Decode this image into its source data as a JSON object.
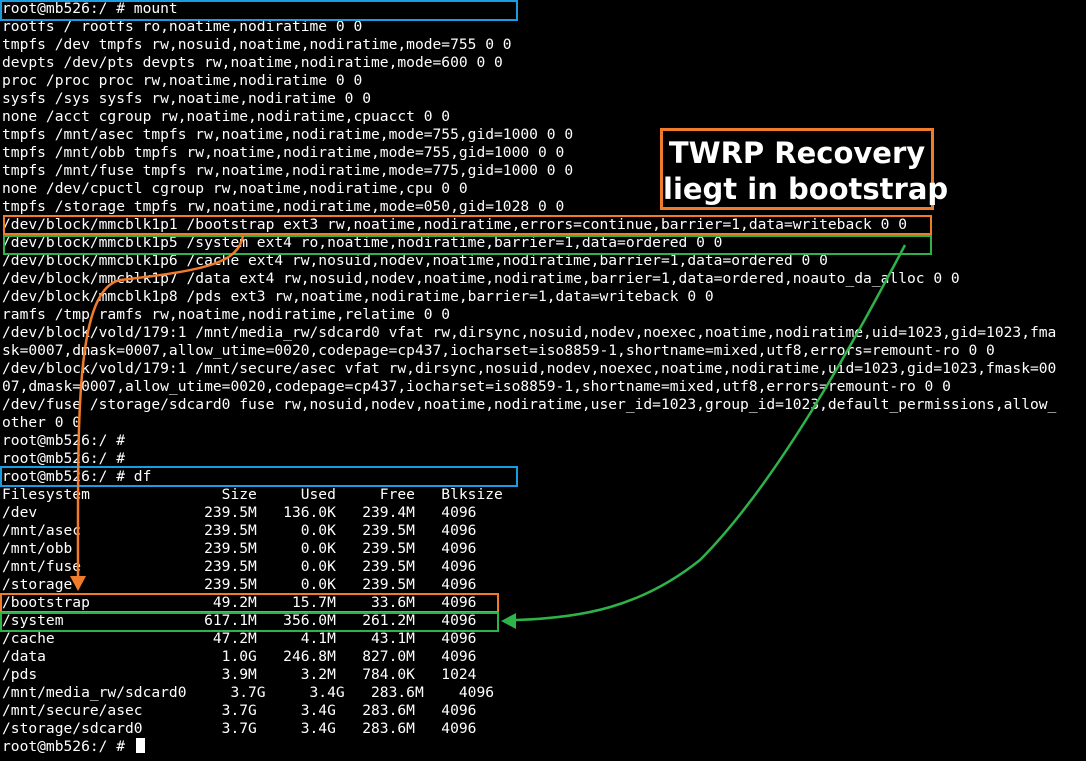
{
  "terminal": {
    "lines": [
      "root@mb526:/ # mount",
      "rootfs / rootfs ro,noatime,nodiratime 0 0",
      "tmpfs /dev tmpfs rw,nosuid,noatime,nodiratime,mode=755 0 0",
      "devpts /dev/pts devpts rw,noatime,nodiratime,mode=600 0 0",
      "proc /proc proc rw,noatime,nodiratime 0 0",
      "sysfs /sys sysfs rw,noatime,nodiratime 0 0",
      "none /acct cgroup rw,noatime,nodiratime,cpuacct 0 0",
      "tmpfs /mnt/asec tmpfs rw,noatime,nodiratime,mode=755,gid=1000 0 0",
      "tmpfs /mnt/obb tmpfs rw,noatime,nodiratime,mode=755,gid=1000 0 0",
      "tmpfs /mnt/fuse tmpfs rw,noatime,nodiratime,mode=775,gid=1000 0 0",
      "none /dev/cpuctl cgroup rw,noatime,nodiratime,cpu 0 0",
      "tmpfs /storage tmpfs rw,noatime,nodiratime,mode=050,gid=1028 0 0",
      "/dev/block/mmcblk1p1 /bootstrap ext3 rw,noatime,nodiratime,errors=continue,barrier=1,data=writeback 0 0",
      "/dev/block/mmcblk1p5 /system ext4 ro,noatime,nodiratime,barrier=1,data=ordered 0 0",
      "/dev/block/mmcblk1p6 /cache ext4 rw,nosuid,nodev,noatime,nodiratime,barrier=1,data=ordered 0 0",
      "/dev/block/mmcblk1p7 /data ext4 rw,nosuid,nodev,noatime,nodiratime,barrier=1,data=ordered,noauto_da_alloc 0 0",
      "/dev/block/mmcblk1p8 /pds ext3 rw,noatime,nodiratime,barrier=1,data=writeback 0 0",
      "ramfs /tmp ramfs rw,noatime,nodiratime,relatime 0 0",
      "/dev/block/vold/179:1 /mnt/media_rw/sdcard0 vfat rw,dirsync,nosuid,nodev,noexec,noatime,nodiratime,uid=1023,gid=1023,fma",
      "sk=0007,dmask=0007,allow_utime=0020,codepage=cp437,iocharset=iso8859-1,shortname=mixed,utf8,errors=remount-ro 0 0",
      "/dev/block/vold/179:1 /mnt/secure/asec vfat rw,dirsync,nosuid,nodev,noexec,noatime,nodiratime,uid=1023,gid=1023,fmask=00",
      "07,dmask=0007,allow_utime=0020,codepage=cp437,iocharset=iso8859-1,shortname=mixed,utf8,errors=remount-ro 0 0",
      "/dev/fuse /storage/sdcard0 fuse rw,nosuid,nodev,noatime,nodiratime,user_id=1023,group_id=1023,default_permissions,allow_",
      "other 0 0",
      "root@mb526:/ #",
      "root@mb526:/ #",
      "root@mb526:/ # df",
      "Filesystem               Size     Used     Free   Blksize",
      "/dev                   239.5M   136.0K   239.4M   4096",
      "/mnt/asec              239.5M     0.0K   239.5M   4096",
      "/mnt/obb               239.5M     0.0K   239.5M   4096",
      "/mnt/fuse              239.5M     0.0K   239.5M   4096",
      "/storage               239.5M     0.0K   239.5M   4096",
      "/bootstrap              49.2M    15.7M    33.6M   4096",
      "/system                617.1M   356.0M   261.2M   4096",
      "/cache                  47.2M     4.1M    43.1M   4096",
      "/data                    1.0G   246.8M   827.0M   4096",
      "/pds                     3.9M     3.2M   784.0K   1024",
      "/mnt/media_rw/sdcard0     3.7G     3.4G   283.6M    4096",
      "/mnt/secure/asec         3.7G     3.4G   283.6M   4096",
      "/storage/sdcard0         3.7G     3.4G   283.6M   4096"
    ],
    "prompt": "root@mb526:/ #"
  },
  "callout": {
    "line1": "TWRP Recovery",
    "line2": "liegt in bootstrap"
  },
  "colors": {
    "command_highlight": "#1a9de0",
    "bootstrap_highlight": "#f07b2a",
    "system_highlight": "#2db34a"
  }
}
